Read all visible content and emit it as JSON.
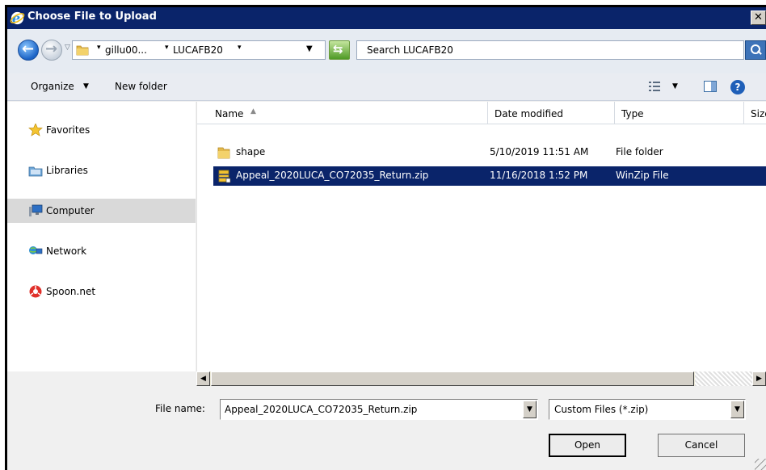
{
  "window": {
    "title": "Choose File to Upload",
    "close_label": "✕"
  },
  "address_bar": {
    "breadcrumbs": [
      "gillu00...",
      "LUCAFB20"
    ],
    "search_placeholder": "Search LUCAFB20"
  },
  "toolbar": {
    "organize_label": "Organize",
    "new_folder_label": "New folder"
  },
  "nav_pane": {
    "items": [
      {
        "label": "Favorites",
        "icon": "star-icon"
      },
      {
        "label": "Libraries",
        "icon": "libraries-icon"
      },
      {
        "label": "Computer",
        "icon": "computer-icon",
        "selected": true
      },
      {
        "label": "Network",
        "icon": "network-icon"
      },
      {
        "label": "Spoon.net",
        "icon": "spoon-icon"
      }
    ]
  },
  "file_list": {
    "columns": [
      "Name",
      "Date modified",
      "Type",
      "Size"
    ],
    "rows": [
      {
        "name": "shape",
        "date": "5/10/2019 11:51 AM",
        "type": "File folder",
        "icon": "folder-icon"
      },
      {
        "name": "Appeal_2020LUCA_CO72035_Return.zip",
        "date": "11/16/2018 1:52 PM",
        "type": "WinZip File",
        "icon": "zip-icon",
        "selected": true
      }
    ]
  },
  "footer": {
    "file_name_label": "File name:",
    "file_name_value": "Appeal_2020LUCA_CO72035_Return.zip",
    "filter_value": "Custom Files (*.zip)",
    "open_label": "Open",
    "cancel_label": "Cancel"
  },
  "colors": {
    "title_bar": "#0a246a",
    "selection": "#0a246a",
    "dialog_bg": "#f0f0f0"
  }
}
